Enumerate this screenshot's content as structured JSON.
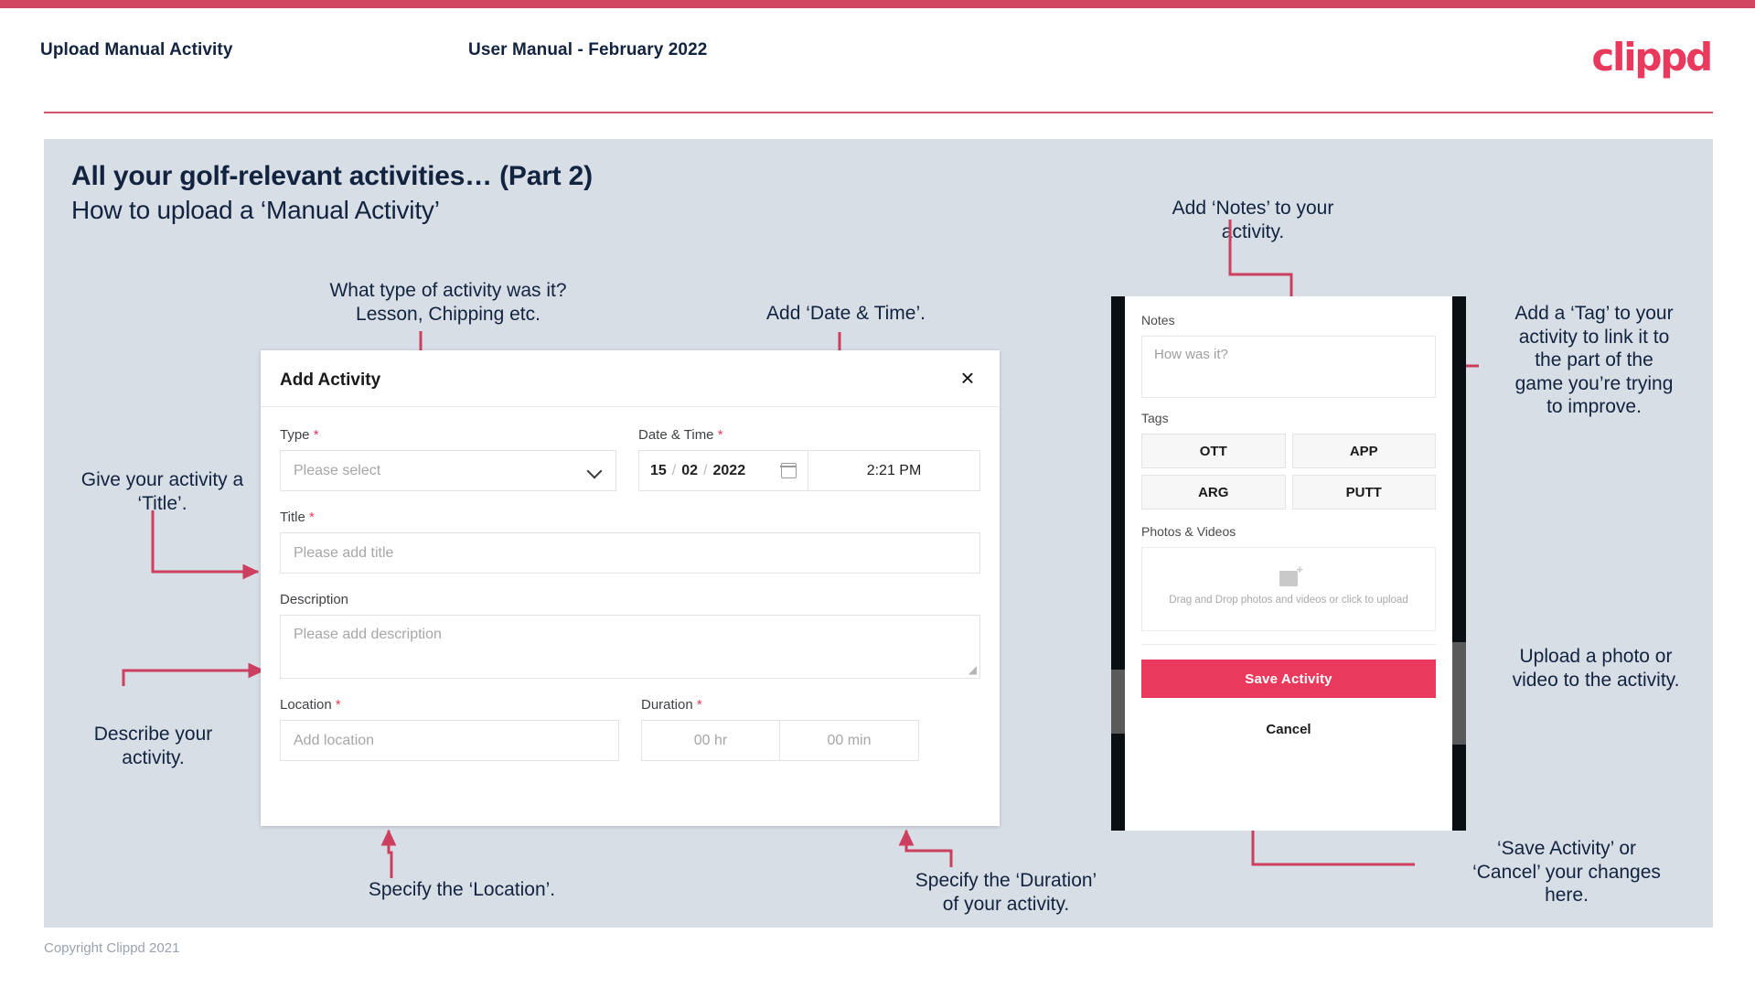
{
  "header": {
    "title": "Upload Manual Activity",
    "subtitle": "User Manual - February 2022",
    "logo": "clippd"
  },
  "slide": {
    "title": "All your golf-relevant activities… (Part 2)",
    "subtitle": "How to upload a ‘Manual Activity’"
  },
  "annotations": {
    "type": "What type of activity was it?\nLesson, Chipping etc.",
    "datetime": "Add ‘Date & Time’.",
    "title_field": "Give your activity a\n‘Title’.",
    "description": "Describe your\nactivity.",
    "location": "Specify the ‘Location’.",
    "duration": "Specify the ‘Duration’\nof your activity.",
    "notes": "Add ‘Notes’ to your\nactivity.",
    "tags": "Add a ‘Tag’ to your\nactivity to link it to\nthe part of the\ngame you’re trying\nto improve.",
    "photos": "Upload a photo or\nvideo to the activity.",
    "save": "‘Save Activity’ or\n‘Cancel’ your changes\nhere."
  },
  "dialog": {
    "title": "Add Activity",
    "close_icon": "×",
    "type": {
      "label": "Type",
      "required": "*",
      "placeholder": "Please select"
    },
    "datetime": {
      "label": "Date & Time",
      "required": "*",
      "day": "15",
      "month": "02",
      "year": "2022",
      "sep": "/",
      "time": "2:21 PM"
    },
    "title_field": {
      "label": "Title",
      "required": "*",
      "placeholder": "Please add title"
    },
    "description": {
      "label": "Description",
      "placeholder": "Please add description"
    },
    "location": {
      "label": "Location",
      "required": "*",
      "placeholder": "Add location"
    },
    "duration": {
      "label": "Duration",
      "required": "*",
      "hours": "00 hr",
      "minutes": "00 min"
    }
  },
  "phone": {
    "notes_label": "Notes",
    "notes_placeholder": "How was it?",
    "tags_label": "Tags",
    "tags": [
      "OTT",
      "APP",
      "ARG",
      "PUTT"
    ],
    "photos_label": "Photos & Videos",
    "upload_text": "Drag and Drop photos and videos or\nclick to upload",
    "save_label": "Save Activity",
    "cancel_label": "Cancel"
  },
  "footer": {
    "copyright": "Copyright Clippd 2021"
  },
  "colors": {
    "accent": "#e93a5d",
    "top_bar": "#d04560",
    "slide_bg": "#d7dee6",
    "text_dark": "#12233f"
  }
}
